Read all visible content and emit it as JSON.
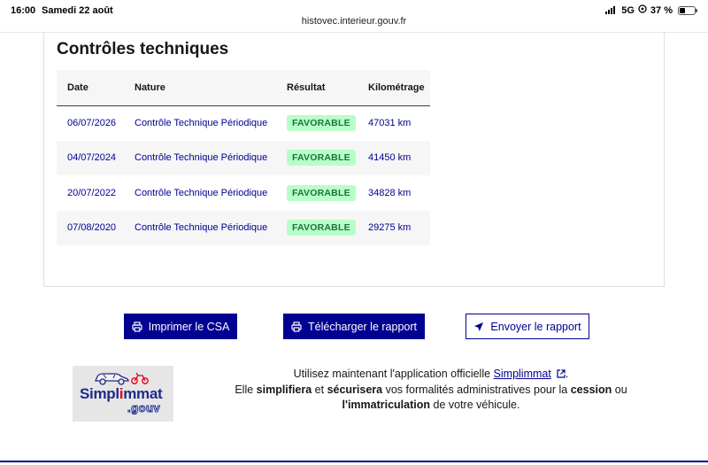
{
  "status_bar": {
    "time": "16:00",
    "date": "Samedi 22 août",
    "network": "5G",
    "battery": "37 %"
  },
  "browser": {
    "url": "histovec.interieur.gouv.fr"
  },
  "section": {
    "title": "Contrôles techniques",
    "columns": [
      "Date",
      "Nature",
      "Résultat",
      "Kilométrage"
    ],
    "rows": [
      {
        "date": "06/07/2026",
        "nature": "Contrôle Technique Périodique",
        "result": "FAVORABLE",
        "km": "47031 km"
      },
      {
        "date": "04/07/2024",
        "nature": "Contrôle Technique Périodique",
        "result": "FAVORABLE",
        "km": "41450 km"
      },
      {
        "date": "20/07/2022",
        "nature": "Contrôle Technique Périodique",
        "result": "FAVORABLE",
        "km": "34828 km"
      },
      {
        "date": "07/08/2020",
        "nature": "Contrôle Technique Périodique",
        "result": "FAVORABLE",
        "km": "29275 km"
      }
    ]
  },
  "actions": {
    "print_label": "Imprimer le CSA",
    "download_label": "Télécharger le rapport",
    "send_label": "Envoyer le rapport"
  },
  "promo": {
    "logo_text_1": "Simpl",
    "logo_text_red": "i",
    "logo_text_2": "mmat",
    "logo_suffix": ".gouv",
    "line1_prefix": "Utilisez maintenant l'application officielle ",
    "link_label": "Simplimmat",
    "line1_suffix": ".",
    "line2_a": "Elle ",
    "line2_b": "simplifiera",
    "line2_c": " et ",
    "line2_d": "sécurisera",
    "line2_e": " vos formalités administratives pour la ",
    "line2_f": "cession",
    "line2_g": " ou",
    "line3_a": "l'immatriculation",
    "line3_b": " de votre véhicule."
  },
  "colors": {
    "primary": "#000091",
    "badge_bg": "#b8fec9",
    "badge_text": "#18753c"
  },
  "icons": {
    "print": "printer-icon",
    "download": "printer-icon",
    "send": "send-arrow-icon",
    "external": "external-link-icon"
  }
}
